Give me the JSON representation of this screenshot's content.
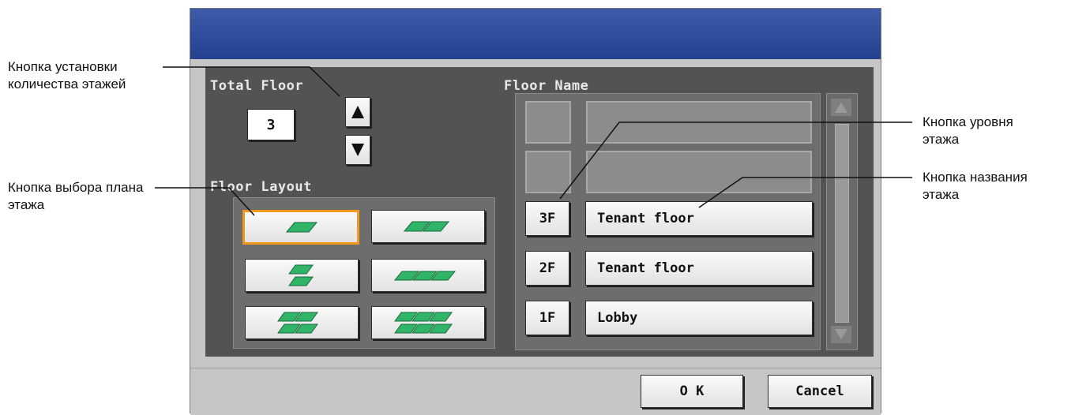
{
  "dialog": {
    "title": "",
    "total_floor_label": "Total Floor",
    "total_floor_value": "3",
    "floor_name_label": "Floor Name",
    "floor_layout_label": "Floor Layout",
    "floors": [
      {
        "level": "",
        "name": ""
      },
      {
        "level": "",
        "name": ""
      },
      {
        "level": "3F",
        "name": "Tenant floor"
      },
      {
        "level": "2F",
        "name": "Tenant floor"
      },
      {
        "level": "1F",
        "name": "Lobby"
      }
    ],
    "ok_label": "O K",
    "cancel_label": "Cancel",
    "layout_options": [
      "1",
      "2",
      "1x2",
      "3",
      "2x2",
      "3x2"
    ],
    "selected_layout": "1"
  },
  "annotations": {
    "floor_count_button": "Кнопка установки количества этажей",
    "floor_layout_button": "Кнопка выбора плана этажа",
    "floor_level_button": "Кнопка уровня этажа",
    "floor_name_button": "Кнопка названия этажа"
  },
  "colors": {
    "title_bar": "#2f4d9c",
    "panel_bg": "#535353",
    "selected_outline": "#ef9a1e",
    "floor_icon_green": "#2fb468"
  }
}
